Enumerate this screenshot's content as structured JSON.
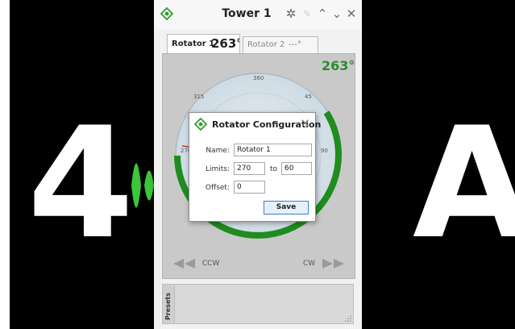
{
  "background_overlay": {
    "left_text": "4",
    "right_text": "A"
  },
  "window": {
    "title": "Tower 1",
    "controls": [
      "settings-icon",
      "pin-icon",
      "chevron-up-icon",
      "chevron-down-icon",
      "close-icon"
    ]
  },
  "tabs": [
    {
      "label": "Rotator 1",
      "value": "263°",
      "active": true
    },
    {
      "label": "Rotator 2",
      "value": "---°",
      "active": false
    }
  ],
  "rotator": {
    "heading_readout": "263°",
    "heading_degrees": 263,
    "compass_labels": [
      "360",
      "45",
      "90",
      "315",
      "270"
    ],
    "ccw_label": "CCW",
    "cw_label": "CW"
  },
  "dialog": {
    "title": "Rotator Configuration",
    "name_label": "Name:",
    "name_value": "Rotator 1",
    "limits_label": "Limits:",
    "limit_from": "270",
    "to_label": "to",
    "limit_to": "60",
    "offset_label": "Offset:",
    "offset_value": "0",
    "save_label": "Save"
  },
  "presets": {
    "label": "Presets"
  },
  "colors": {
    "accent_green": "#2e8b2e",
    "save_border": "#3c7fd0",
    "background": "#000000"
  }
}
